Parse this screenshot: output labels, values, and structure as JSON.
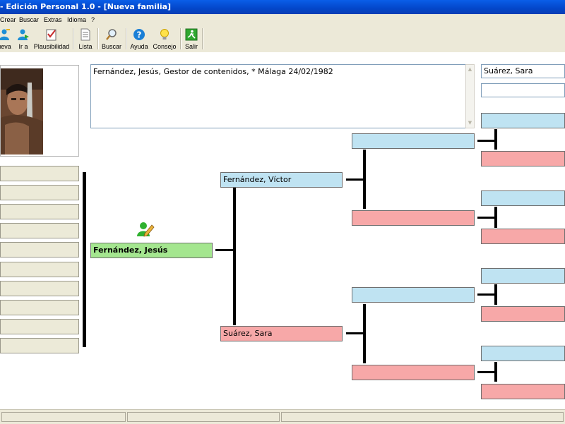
{
  "window": {
    "title": "- Edición Personal 1.0 - [Nueva familia]"
  },
  "menu": [
    "Crear",
    "Buscar",
    "Extras",
    "Idioma",
    "?"
  ],
  "toolbar": [
    {
      "label": "ueva",
      "icon": "person-new-icon"
    },
    {
      "label": "Ir a",
      "icon": "person-goto-icon"
    },
    {
      "label": "Plausibilidad",
      "icon": "checklist-icon"
    },
    {
      "label": "Lista",
      "icon": "document-list-icon"
    },
    {
      "label": "Buscar",
      "icon": "magnifier-icon"
    },
    {
      "label": "Ayuda",
      "icon": "help-icon"
    },
    {
      "label": "Consejo",
      "icon": "lightbulb-icon"
    },
    {
      "label": "Salir",
      "icon": "exit-icon"
    }
  ],
  "note": {
    "text": "Fernández, Jesús, Gestor de contenidos, * Málaga 24/02/1982"
  },
  "search": {
    "value": "Suárez, Sara"
  },
  "tree": {
    "focus": "Fernández, Jesús",
    "father": "Fernández, Víctor",
    "mother": "Suárez, Sara"
  },
  "colors": {
    "male": "#bfe3f2",
    "female": "#f7a8a8",
    "focus": "#a4e68f",
    "titlebar": "#0346c9"
  }
}
